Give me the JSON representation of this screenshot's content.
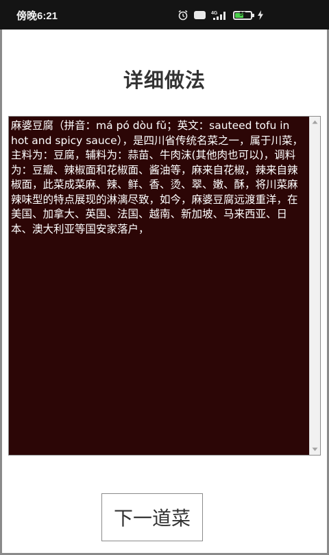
{
  "status_bar": {
    "time": "傍晚6:21",
    "icons": [
      "alarm-icon",
      "hd-icon",
      "signal-icon",
      "battery-icon",
      "charging-icon"
    ],
    "hd_label": "HD",
    "network_label": "4G",
    "battery_level": "55",
    "battery_fraction": 0.55,
    "battery_color": "#4cd04c"
  },
  "page": {
    "title": "详细做法"
  },
  "recipe": {
    "description": "麻婆豆腐（拼音：má pó dòu fǔ；英文：sauteed tofu in hot and spicy sauce），是四川省传统名菜之一，属于川菜，主料为：豆腐，辅料为：蒜苗、牛肉沫(其他肉也可以)，调料为：豆瓣、辣椒面和花椒面、酱油等，麻来自花椒，辣来自辣椒面，此菜成菜麻、辣、鲜、香、烫、翠、嫩、酥，将川菜麻辣味型的特点展现的淋漓尽致，如今，麻婆豆腐远渡重洋，在美国、加拿大、英国、法国、越南、新加坡、马来西亚、日本、澳大利亚等国安家落户，",
    "background_color": "#2c0606",
    "text_color": "#ffffff"
  },
  "actions": {
    "next_label": "下一道菜"
  }
}
